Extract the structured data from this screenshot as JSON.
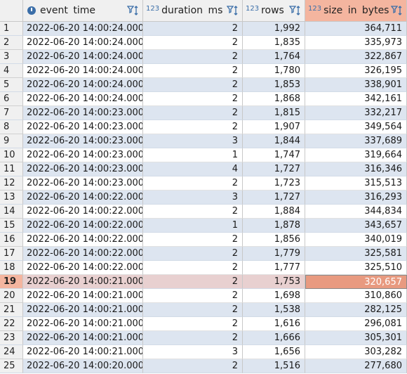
{
  "columns": [
    {
      "label": "event time",
      "type_badge": "clock-icon"
    },
    {
      "label": "duration ms",
      "type_badge": "123"
    },
    {
      "label": "rows",
      "type_badge": "123"
    },
    {
      "label": "size in bytes",
      "type_badge": "123"
    }
  ],
  "selected_row": 19,
  "selected_column": 3,
  "colors": {
    "selection": "#f4b59f",
    "selected_cell": "#e89a80",
    "alt_row": "#dde5f0",
    "badge": "#3b6ea8"
  },
  "rows": [
    [
      "1",
      "2022-06-20 14:00:24.000",
      "2",
      "1,992",
      "364,711"
    ],
    [
      "2",
      "2022-06-20 14:00:24.000",
      "2",
      "1,835",
      "335,973"
    ],
    [
      "3",
      "2022-06-20 14:00:24.000",
      "2",
      "1,764",
      "322,867"
    ],
    [
      "4",
      "2022-06-20 14:00:24.000",
      "2",
      "1,780",
      "326,195"
    ],
    [
      "5",
      "2022-06-20 14:00:24.000",
      "2",
      "1,853",
      "338,901"
    ],
    [
      "6",
      "2022-06-20 14:00:24.000",
      "2",
      "1,868",
      "342,161"
    ],
    [
      "7",
      "2022-06-20 14:00:23.000",
      "2",
      "1,815",
      "332,217"
    ],
    [
      "8",
      "2022-06-20 14:00:23.000",
      "2",
      "1,907",
      "349,564"
    ],
    [
      "9",
      "2022-06-20 14:00:23.000",
      "3",
      "1,844",
      "337,689"
    ],
    [
      "10",
      "2022-06-20 14:00:23.000",
      "1",
      "1,747",
      "319,664"
    ],
    [
      "11",
      "2022-06-20 14:00:23.000",
      "4",
      "1,727",
      "316,346"
    ],
    [
      "12",
      "2022-06-20 14:00:23.000",
      "2",
      "1,723",
      "315,513"
    ],
    [
      "13",
      "2022-06-20 14:00:22.000",
      "3",
      "1,727",
      "316,293"
    ],
    [
      "14",
      "2022-06-20 14:00:22.000",
      "2",
      "1,884",
      "344,834"
    ],
    [
      "15",
      "2022-06-20 14:00:22.000",
      "1",
      "1,878",
      "343,657"
    ],
    [
      "16",
      "2022-06-20 14:00:22.000",
      "2",
      "1,856",
      "340,019"
    ],
    [
      "17",
      "2022-06-20 14:00:22.000",
      "2",
      "1,779",
      "325,581"
    ],
    [
      "18",
      "2022-06-20 14:00:22.000",
      "2",
      "1,777",
      "325,510"
    ],
    [
      "19",
      "2022-06-20 14:00:21.000",
      "2",
      "1,753",
      "320,657"
    ],
    [
      "20",
      "2022-06-20 14:00:21.000",
      "2",
      "1,698",
      "310,860"
    ],
    [
      "21",
      "2022-06-20 14:00:21.000",
      "2",
      "1,538",
      "282,125"
    ],
    [
      "22",
      "2022-06-20 14:00:21.000",
      "2",
      "1,616",
      "296,081"
    ],
    [
      "23",
      "2022-06-20 14:00:21.000",
      "2",
      "1,666",
      "305,301"
    ],
    [
      "24",
      "2022-06-20 14:00:21.000",
      "3",
      "1,656",
      "303,282"
    ],
    [
      "25",
      "2022-06-20 14:00:20.000",
      "2",
      "1,516",
      "277,680"
    ]
  ]
}
